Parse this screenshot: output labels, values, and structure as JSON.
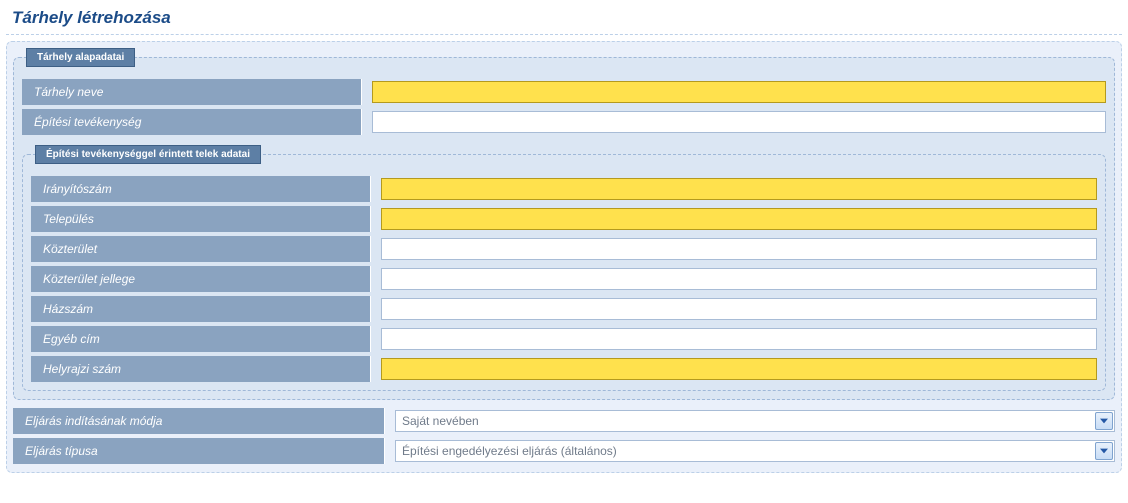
{
  "title": "Tárhely létrehozása",
  "group1": {
    "legend": "Tárhely alapadatai",
    "name_label": "Tárhely neve",
    "name_value": "",
    "activity_label": "Építési tevékenység",
    "activity_value": ""
  },
  "group2": {
    "legend": "Építési tevékenységgel érintett telek adatai",
    "zip_label": "Irányítószám",
    "zip_value": "",
    "city_label": "Település",
    "city_value": "",
    "street_label": "Közterület",
    "street_value": "",
    "street_type_label": "Közterület jellege",
    "street_type_value": "",
    "house_label": "Házszám",
    "house_value": "",
    "other_label": "Egyéb cím",
    "other_value": "",
    "lotnum_label": "Helyrajzi szám",
    "lotnum_value": ""
  },
  "proc_start_label": "Eljárás indításának módja",
  "proc_start_value": "Saját nevében",
  "proc_type_label": "Eljárás típusa",
  "proc_type_value": "Építési engedélyezési eljárás (általános)"
}
